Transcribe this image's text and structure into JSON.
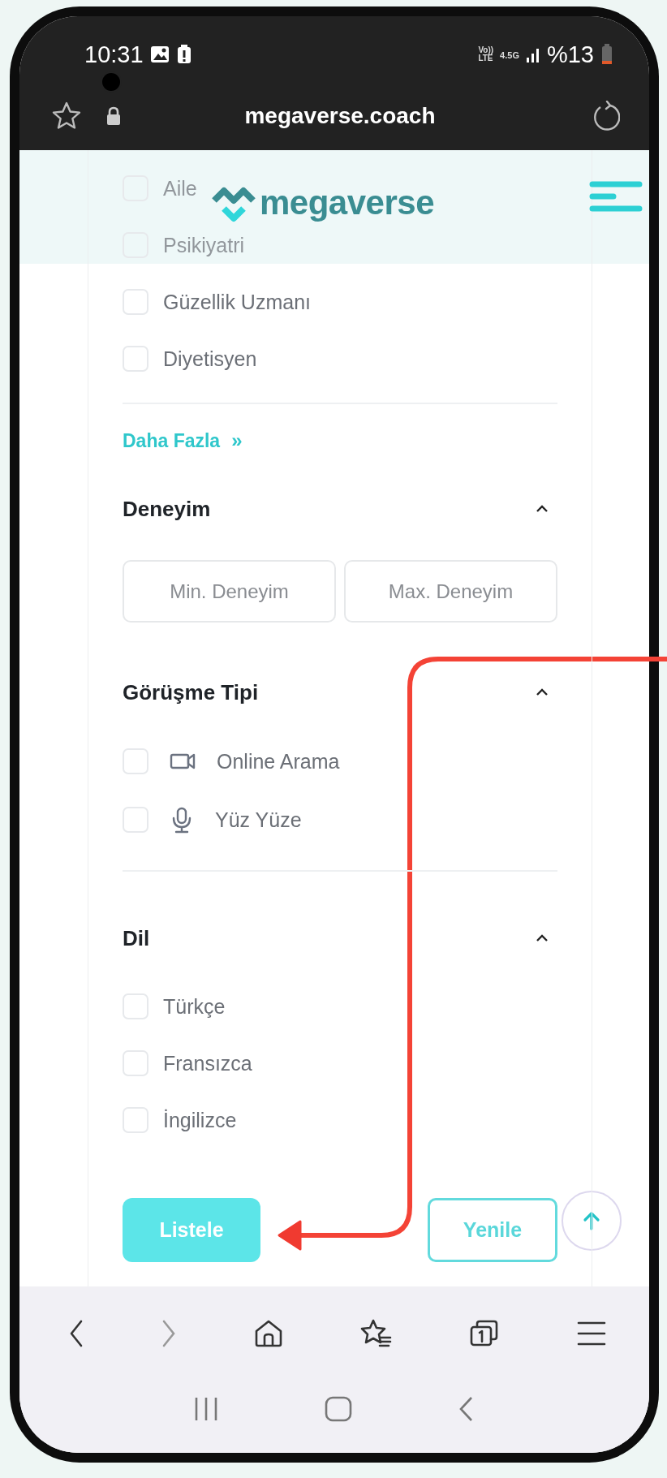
{
  "status_bar": {
    "time": "10:31",
    "volte": "Vo))",
    "lte": "LTE",
    "network": "4.5G",
    "battery": "%13"
  },
  "browser": {
    "url": "megaverse.coach"
  },
  "header": {
    "logo": "megaverse"
  },
  "filters": {
    "specialties": [
      {
        "label": "Aile",
        "checked": false
      },
      {
        "label": "Psikiyatri",
        "checked": false
      },
      {
        "label": "Güzellik Uzmanı",
        "checked": false
      },
      {
        "label": "Diyetisyen",
        "checked": false
      }
    ],
    "more_link": {
      "label": "Daha Fazla",
      "glyph": "»"
    },
    "sections": [
      {
        "title": "Deneyim",
        "expanded": true,
        "kind": "range",
        "fields": [
          {
            "placeholder": "Min. Deneyim"
          },
          {
            "placeholder": "Max. Deneyim"
          }
        ]
      },
      {
        "title": "Görüşme Tipi",
        "expanded": true,
        "kind": "options",
        "options": [
          {
            "label": "Online Arama",
            "kind": "video",
            "checked": false
          },
          {
            "label": "Yüz Yüze",
            "kind": "mic",
            "checked": false
          }
        ]
      },
      {
        "title": "Dil",
        "expanded": true,
        "kind": "options",
        "options": [
          {
            "label": "Türkçe",
            "checked": false
          },
          {
            "label": "Fransızca",
            "checked": false
          },
          {
            "label": "İngilizce",
            "checked": false
          }
        ]
      }
    ],
    "buttons": {
      "primary": "Listele",
      "secondary": "Yenile"
    }
  }
}
